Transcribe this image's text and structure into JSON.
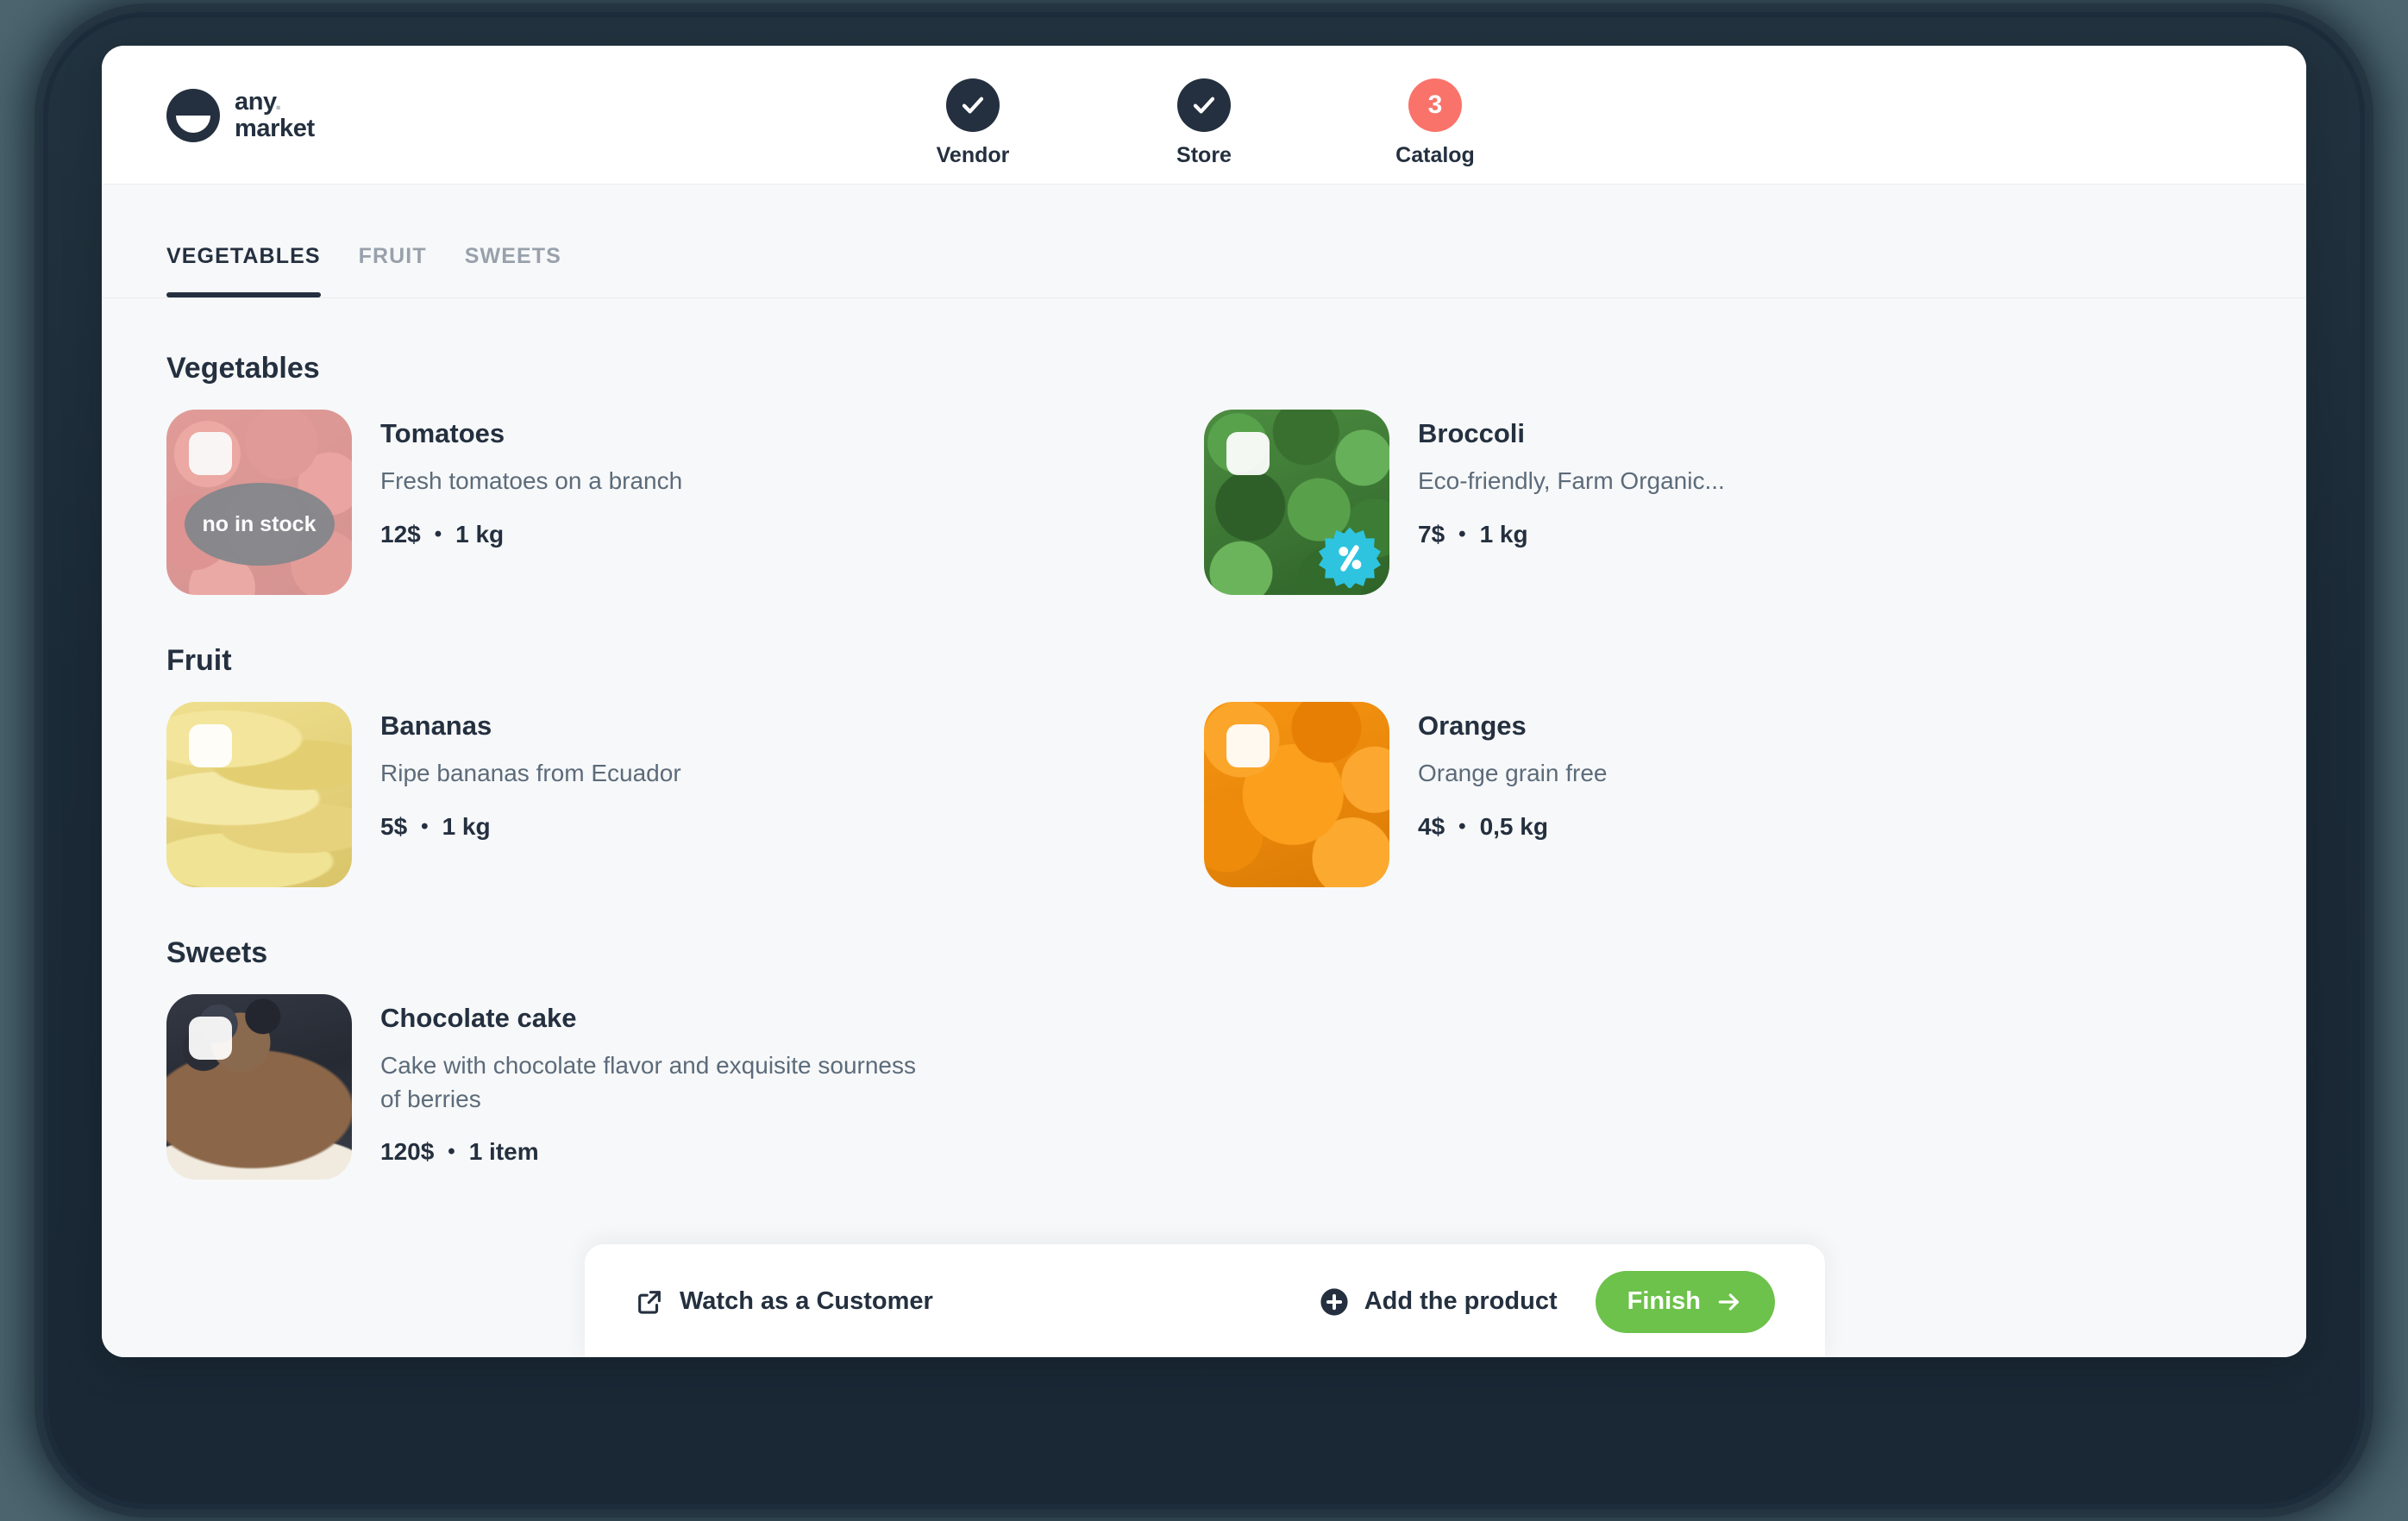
{
  "brand": {
    "name_line1": "any",
    "name_dot": ".",
    "name_line2": "market",
    "logo_icon": "smile-bowl-logo-icon"
  },
  "steps": [
    {
      "label": "Vendor",
      "state": "complete",
      "icon": "check-icon",
      "badge": ""
    },
    {
      "label": "Store",
      "state": "complete",
      "icon": "check-icon",
      "badge": ""
    },
    {
      "label": "Catalog",
      "state": "current",
      "icon": "",
      "badge": "3",
      "color": "#f9736b"
    }
  ],
  "tabs": [
    {
      "label": "VEGETABLES",
      "active": true
    },
    {
      "label": "FRUIT",
      "active": false
    },
    {
      "label": "SWEETS",
      "active": false
    }
  ],
  "sections": [
    {
      "title": "Vegetables",
      "products": [
        {
          "name": "Tomatoes",
          "description": "Fresh tomatoes on a branch",
          "price": "12$",
          "separator": "•",
          "quantity": "1 kg",
          "stock_badge": "no in stock",
          "discount_badge": false,
          "image": "img-tomatoes",
          "faded": true
        },
        {
          "name": "Broccoli",
          "description": "Eco-friendly, Farm Organic...",
          "price": "7$",
          "separator": "•",
          "quantity": "1 kg",
          "stock_badge": "",
          "discount_badge": true,
          "image": "img-broccoli",
          "faded": false
        }
      ]
    },
    {
      "title": "Fruit",
      "products": [
        {
          "name": "Bananas",
          "description": "Ripe bananas from Ecuador",
          "price": "5$",
          "separator": "•",
          "quantity": "1 kg",
          "stock_badge": "",
          "discount_badge": false,
          "image": "img-bananas",
          "faded": false
        },
        {
          "name": "Oranges",
          "description": "Orange grain free",
          "price": "4$",
          "separator": "•",
          "quantity": "0,5 kg",
          "stock_badge": "",
          "discount_badge": false,
          "image": "img-oranges",
          "faded": false
        }
      ]
    },
    {
      "title": "Sweets",
      "products": [
        {
          "name": "Chocolate cake",
          "description": "Cake with chocolate flavor and exquisite sourness of berries",
          "price": "120$",
          "separator": "•",
          "quantity": "1 item",
          "stock_badge": "",
          "discount_badge": false,
          "image": "img-cake",
          "faded": false
        }
      ]
    }
  ],
  "actionbar": {
    "watch_label": "Watch as a Customer",
    "watch_icon": "external-link-icon",
    "add_label": "Add the product",
    "add_icon": "plus-circle-icon",
    "finish_label": "Finish",
    "finish_icon": "arrow-right-icon",
    "finish_color": "#6cc24a"
  },
  "colors": {
    "ink": "#24303f",
    "muted": "#5c6b7a",
    "page_bg": "#f7f8f9",
    "accent_coral": "#f9736b",
    "accent_cyan": "#2ec4e0",
    "accent_green": "#6cc24a",
    "frame": "#1d2c3a",
    "desktop_bg": "#4d6670"
  }
}
